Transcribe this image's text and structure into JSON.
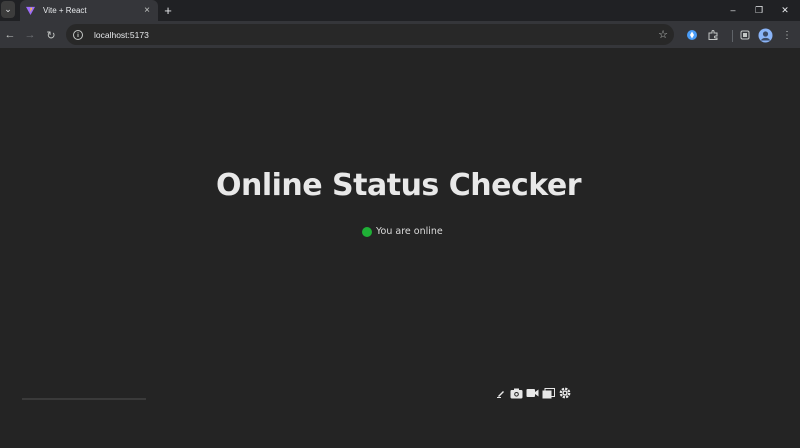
{
  "browser": {
    "tab": {
      "title": "Vite + React",
      "close_glyph": "×"
    },
    "new_tab_glyph": "+",
    "window_controls": {
      "minimize": "–",
      "restore": "❐",
      "close": "✕"
    },
    "address": {
      "url": "localhost:5173"
    },
    "nav": {
      "back": "←",
      "forward": "→",
      "reload": "↻"
    },
    "toolbar_icons": [
      "star-icon",
      "extension-pin-icon",
      "puzzle-icon",
      "sidebar-icon",
      "profile-avatar-icon"
    ]
  },
  "page": {
    "title": "Online Status Checker",
    "status_text": "You are online",
    "status_color": "#1fb036"
  },
  "bottom_toolbar": [
    "pen-icon",
    "camera-icon",
    "video-icon",
    "copy-icon",
    "settings-icon"
  ],
  "colors": {
    "background": "#242424",
    "title_bar": "#202124",
    "toolbar": "#35363a"
  }
}
